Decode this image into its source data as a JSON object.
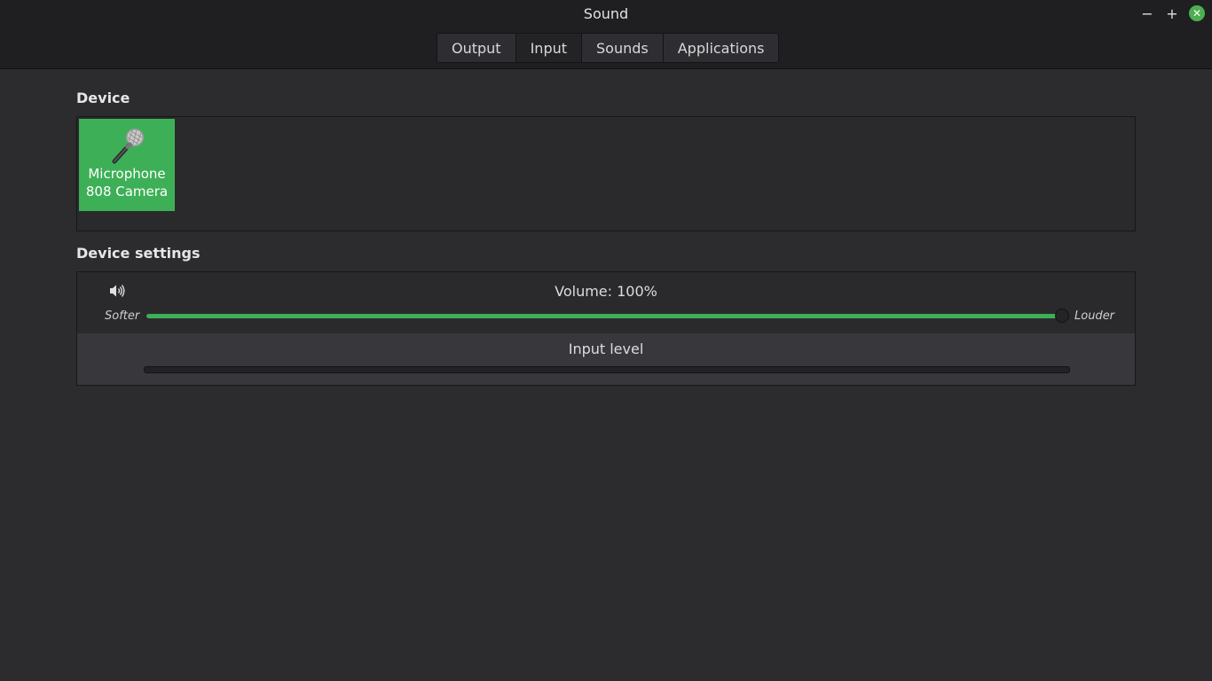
{
  "window": {
    "title": "Sound",
    "controls": {
      "minimize": "−",
      "maximize": "+",
      "close": "✕"
    }
  },
  "tabs": [
    {
      "label": "Output",
      "active": false
    },
    {
      "label": "Input",
      "active": true
    },
    {
      "label": "Sounds",
      "active": false
    },
    {
      "label": "Applications",
      "active": false
    }
  ],
  "device": {
    "heading": "Device",
    "items": [
      {
        "line1": "Microphone",
        "line2": "808 Camera",
        "icon": "microphone-icon",
        "selected": true
      }
    ]
  },
  "settings": {
    "heading": "Device settings",
    "volume_label": "Volume: 100%",
    "volume_fraction": 1.0,
    "softer_label": "Softer",
    "louder_label": "Louder",
    "input_level_label": "Input level",
    "input_level_fraction": 0.0
  },
  "colors": {
    "accent": "#3db057",
    "background": "#2c2c2f",
    "headerbar": "#1f1f22"
  }
}
